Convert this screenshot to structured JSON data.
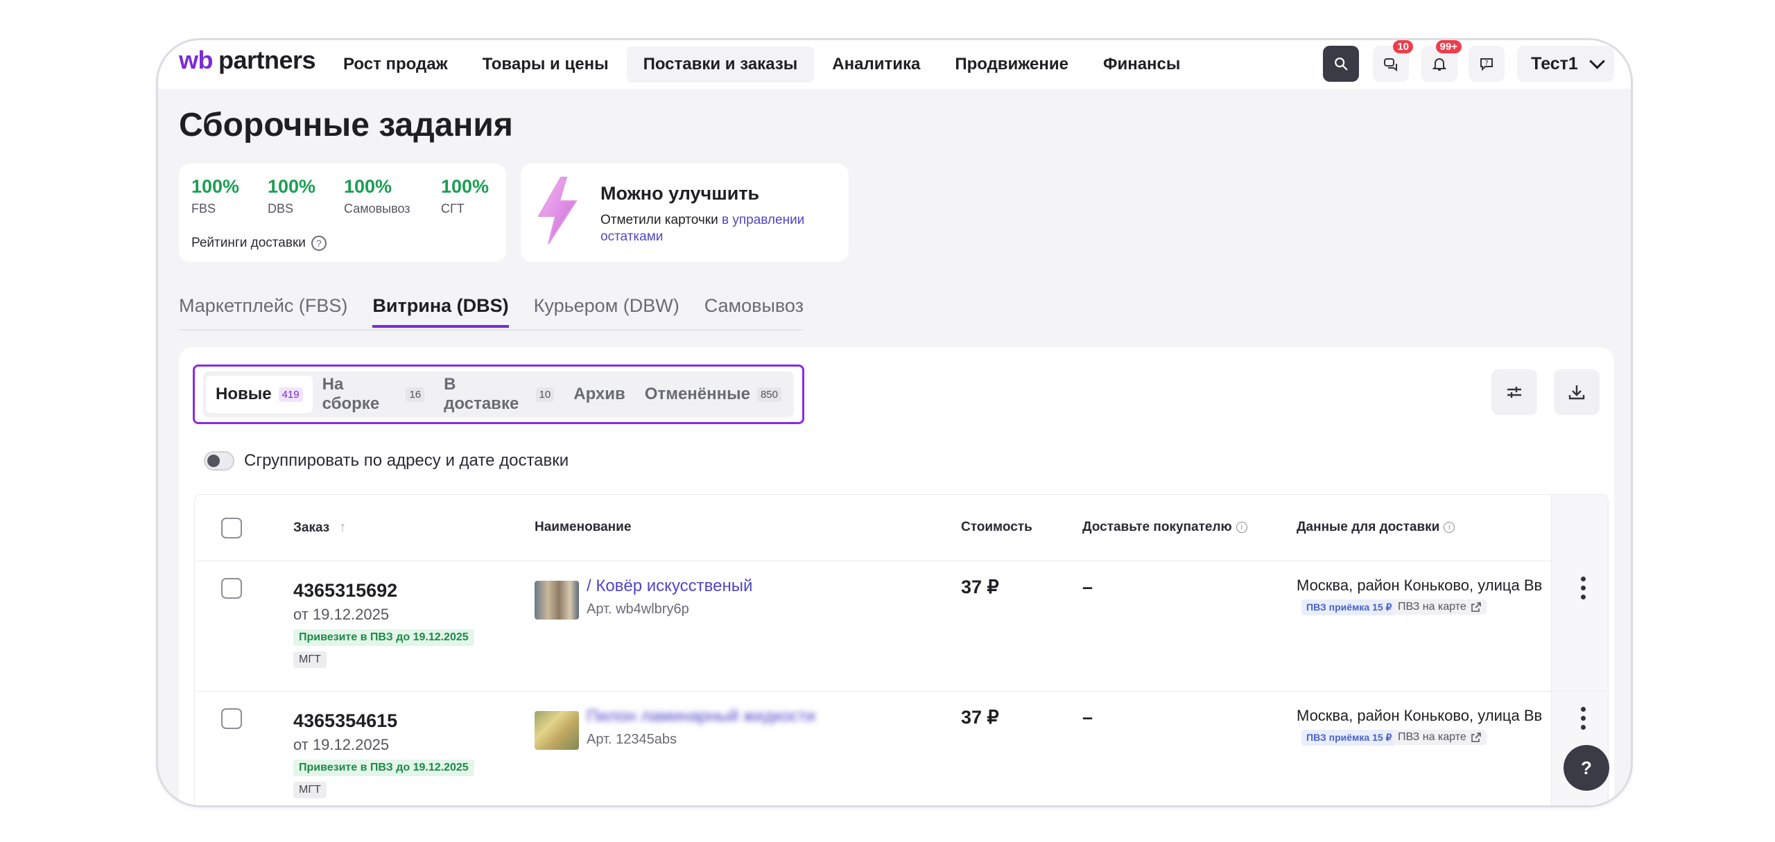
{
  "header": {
    "logo_wb": "wb",
    "logo_partners": "partners",
    "nav": [
      "Рост продаж",
      "Товары и цены",
      "Поставки и заказы",
      "Аналитика",
      "Продвижение",
      "Финансы"
    ],
    "active_nav_index": 2,
    "chat_badge": "10",
    "notif_badge": "99+",
    "user_name": "Тест1"
  },
  "page": {
    "title": "Сборочные задания"
  },
  "ratings": {
    "items": [
      {
        "value": "100%",
        "label": "FBS"
      },
      {
        "value": "100%",
        "label": "DBS"
      },
      {
        "value": "100%",
        "label": "Самовывоз"
      },
      {
        "value": "100%",
        "label": "СГТ"
      }
    ],
    "footer": "Рейтинги доставки",
    "value_color": "#1b9e53"
  },
  "improve": {
    "title": "Можно улучшить",
    "text_prefix": "Отметили карточки ",
    "link_text": "в управлении остатками"
  },
  "tabs": [
    "Маркетплейс (FBS)",
    "Витрина (DBS)",
    "Курьером (DBW)",
    "Самовывоз"
  ],
  "active_tab_index": 1,
  "status_filter": [
    {
      "label": "Новые",
      "count": "419"
    },
    {
      "label": "На сборке",
      "count": "16"
    },
    {
      "label": "В доставке",
      "count": "10"
    },
    {
      "label": "Архив",
      "count": ""
    },
    {
      "label": "Отменённые",
      "count": "850"
    }
  ],
  "toggle_label": "Сгруппировать по адресу и дате доставки",
  "table": {
    "headers": {
      "order": "Заказ",
      "name": "Наименование",
      "price": "Стоимость",
      "deliver": "Доставьте покупателю",
      "delivery_data": "Данные для доставки"
    },
    "rows": [
      {
        "order_no": "4365315692",
        "date": "от 19.12.2025",
        "tag": "Привезите в ПВЗ до 19.12.2025",
        "type": "МГТ",
        "product": "/ Ковёр искусственый",
        "article": "Арт. wb4wlbry6p",
        "price": "37 ₽",
        "deliver": "–",
        "address": "Москва, район Коньково, улица Вв",
        "pvz_badge": "ПВЗ приёмка 15 ₽",
        "pvz_map": "ПВЗ на карте"
      },
      {
        "order_no": "4365354615",
        "date": "от 19.12.2025",
        "tag": "Привезите в ПВЗ до 19.12.2025",
        "type": "МГТ",
        "product": "Пилон ламинарный жидкости",
        "article": "Арт. 12345abs",
        "price": "37 ₽",
        "deliver": "–",
        "address": "Москва, район Коньково, улица Вв",
        "pvz_badge": "ПВЗ приёмка 15 ₽",
        "pvz_map": "ПВЗ на карте"
      }
    ]
  },
  "help_fab": "?",
  "colors": {
    "accent": "#7a2bd8",
    "link": "#4f46c8",
    "success": "#1b9e53"
  }
}
